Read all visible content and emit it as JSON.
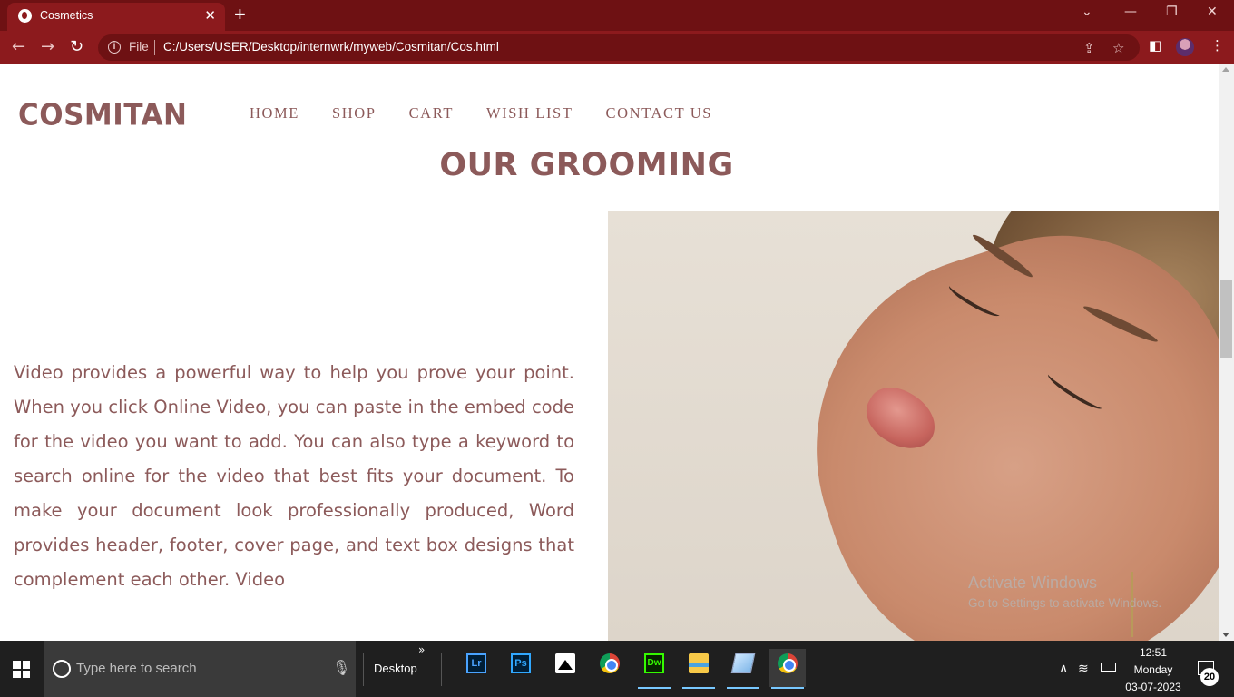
{
  "browser": {
    "tab_title": "Cosmetics",
    "tab_close": "✕",
    "new_tab": "+",
    "file_label": "File",
    "url": "C:/Users/USER/Desktop/internwrk/myweb/Cosmitan/Cos.html",
    "window_controls": {
      "dropdown": "⌄",
      "minimize": "—",
      "restore": "❐",
      "close": "✕"
    }
  },
  "site": {
    "logo": "COSMITAN",
    "nav": [
      "HOME",
      "SHOP",
      "CART",
      "WISH LIST",
      "CONTACT US"
    ],
    "heading": "OUR GROOMING",
    "paragraph": "Video provides a powerful way to help you prove your point. When you click Online Video, you can paste in the embed code for the video you want to add. You can also type a keyword to search online for the video that best fits your document. To make your document look professionally produced, Word provides header, footer, cover page, and text box designs that complement each other. Video",
    "accent_color": "#8c5a5a"
  },
  "watermark": {
    "line1": "Activate Windows",
    "line2": "Go to Settings to activate Windows."
  },
  "taskbar": {
    "search_placeholder": "Type here to search",
    "desktop_label": "Desktop",
    "apps": [
      "Lightroom",
      "Photoshop",
      "Photos",
      "Chrome",
      "Dreamweaver",
      "File Explorer",
      "Notepad",
      "Chrome"
    ],
    "lr_label": "Lr",
    "ps_label": "Ps",
    "dw_label": "Dw",
    "time": "12:51",
    "day": "Monday",
    "date": "03-07-2023",
    "notification_count": "20"
  }
}
